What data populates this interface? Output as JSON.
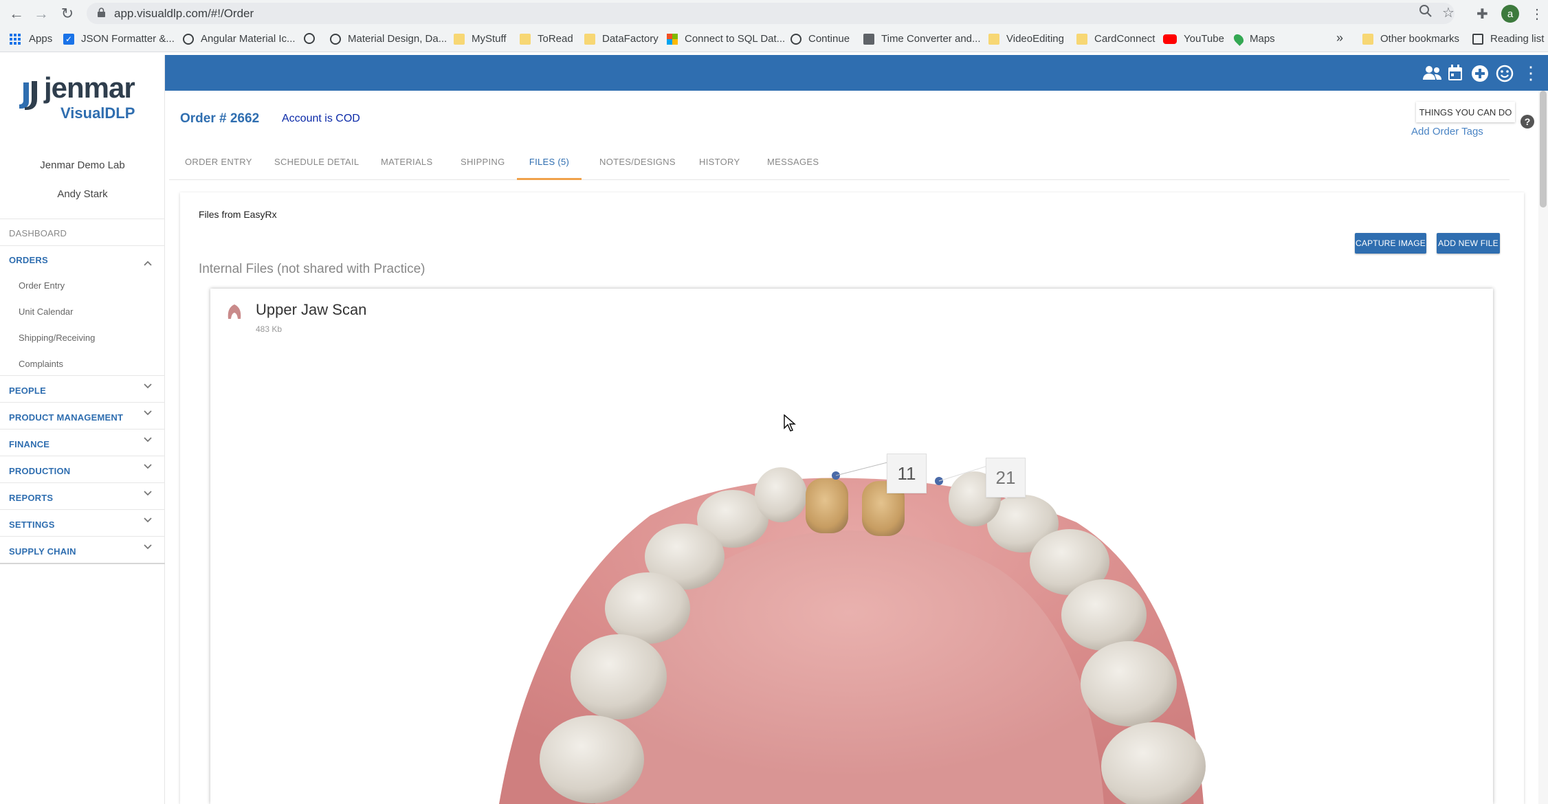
{
  "browser": {
    "url": "app.visualdlp.com/#!/Order",
    "bookmarks": [
      {
        "label": "Apps",
        "icon": "apps-grid-icon"
      },
      {
        "label": "JSON Formatter &...",
        "icon": "check-icon"
      },
      {
        "label": "Angular Material Ic...",
        "icon": "globe-icon"
      },
      {
        "label": "",
        "icon": "globe-icon"
      },
      {
        "label": "Material Design, Da...",
        "icon": "globe-icon"
      },
      {
        "label": "MyStuff",
        "icon": "folder-icon"
      },
      {
        "label": "ToRead",
        "icon": "folder-icon"
      },
      {
        "label": "DataFactory",
        "icon": "folder-icon"
      },
      {
        "label": "Connect to SQL Dat...",
        "icon": "microsoft-icon"
      },
      {
        "label": "Continue",
        "icon": "globe-icon"
      },
      {
        "label": "Time Converter and...",
        "icon": "calendar-icon"
      },
      {
        "label": "VideoEditing",
        "icon": "folder-icon"
      },
      {
        "label": "CardConnect",
        "icon": "folder-icon"
      },
      {
        "label": "YouTube",
        "icon": "youtube-icon"
      },
      {
        "label": "Maps",
        "icon": "maps-icon"
      }
    ],
    "more_bookmarks": "»",
    "other_bookmarks": "Other bookmarks",
    "reading_list": "Reading list",
    "profile_initial": "a"
  },
  "sidebar": {
    "logo_text": "jenmar",
    "logo_sub": "VisualDLP",
    "lab_name": "Jenmar Demo Lab",
    "user_name": "Andy Stark",
    "dashboard": "DASHBOARD",
    "orders": {
      "label": "ORDERS",
      "items": [
        "Order Entry",
        "Unit Calendar",
        "Shipping/Receiving",
        "Complaints"
      ]
    },
    "sections": [
      "PEOPLE",
      "PRODUCT MANAGEMENT",
      "FINANCE",
      "PRODUCTION",
      "REPORTS",
      "SETTINGS",
      "SUPPLY CHAIN"
    ]
  },
  "order": {
    "number": "Order # 2662",
    "account_status": "Account is COD",
    "things_you_can_do": "THINGS YOU CAN DO",
    "add_order_tags": "Add Order Tags",
    "help": "?"
  },
  "tabs": [
    {
      "label": "ORDER ENTRY",
      "active": false
    },
    {
      "label": "SCHEDULE DETAIL",
      "active": false
    },
    {
      "label": "MATERIALS",
      "active": false
    },
    {
      "label": "SHIPPING",
      "active": false
    },
    {
      "label": "FILES (5)",
      "active": true
    },
    {
      "label": "NOTES/DESIGNS",
      "active": false
    },
    {
      "label": "HISTORY",
      "active": false
    },
    {
      "label": "MESSAGES",
      "active": false
    }
  ],
  "files": {
    "files_from": "Files from EasyRx",
    "capture_image": "CAPTURE IMAGE",
    "add_new_file": "ADD NEW FILE",
    "internal_heading": "Internal Files (not shared with Practice)",
    "card": {
      "title": "Upper Jaw Scan",
      "size": "483 Kb",
      "tooth_labels": [
        "11",
        "21"
      ]
    }
  },
  "colors": {
    "brand_blue": "#2f6eb0",
    "active_tab_underline": "#f0a14a"
  }
}
